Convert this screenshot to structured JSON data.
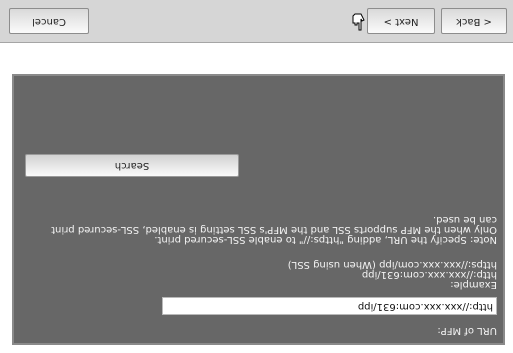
{
  "url_section": {
    "label": "URL of MFP:",
    "value": "http://xxx.xxx.com:631/ipp"
  },
  "example": {
    "heading": "Example:",
    "lines": [
      "http://xxx.xxx.com:631/ipp",
      "https://xxx.xxx.com/ipp (When using SSL)"
    ]
  },
  "note": {
    "lines": [
      "Note: Specify the URL, adding \"https://\" to enable SSL-secured print.",
      "Only when the MFP supports SSL and the MFP's SSL setting is enabled, SSL-secured print",
      "can be used."
    ]
  },
  "search_label": "Search",
  "nav": {
    "back_label": "< Back",
    "next_label": "Next >",
    "cancel_label": "Cancel"
  }
}
